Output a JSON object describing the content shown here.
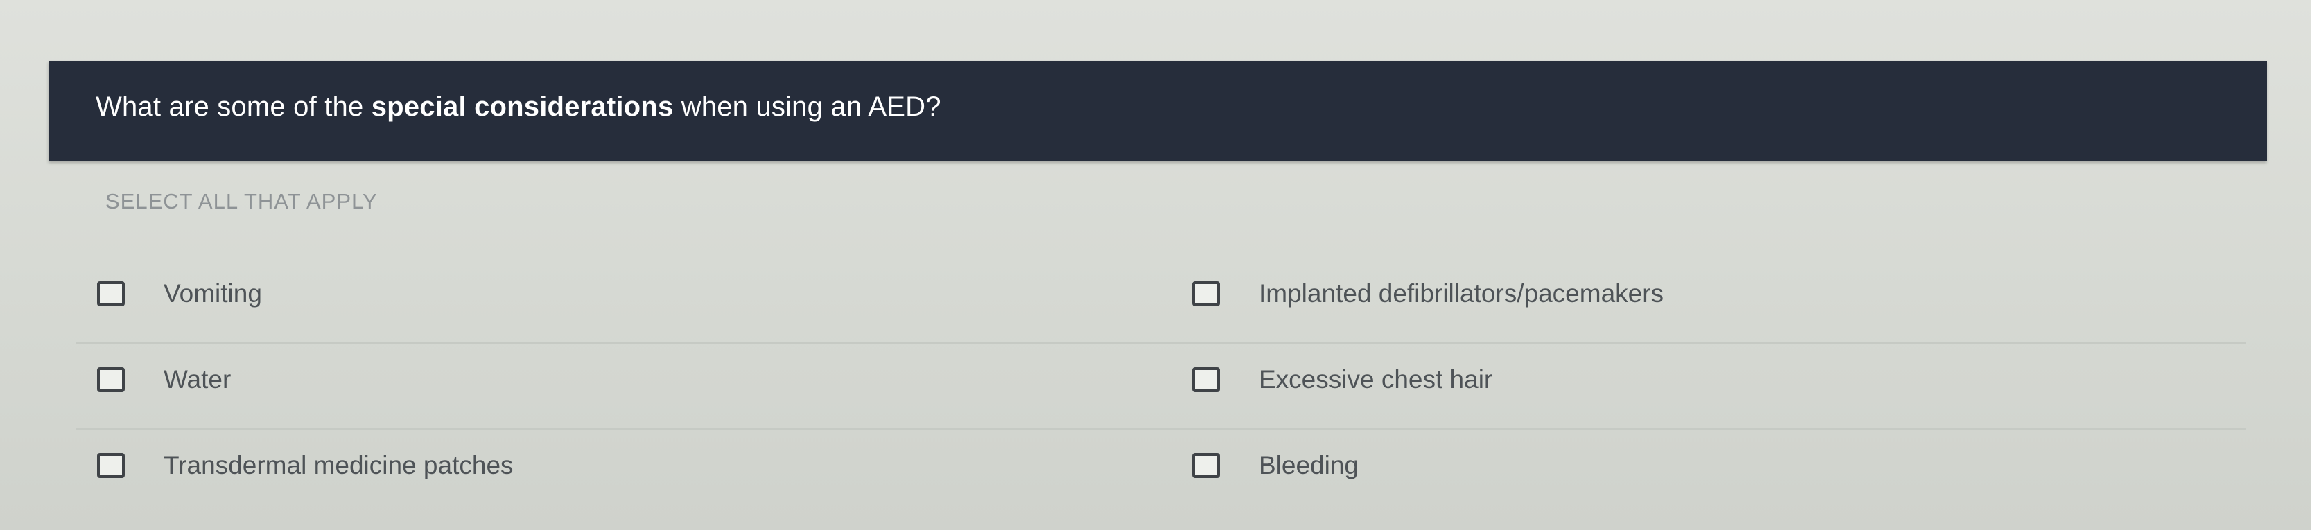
{
  "question": {
    "prefix": "What are some of the ",
    "emphasis": "special considerations",
    "suffix": " when using an AED?"
  },
  "instruction": "SELECT ALL THAT APPLY",
  "options": {
    "left": [
      {
        "label": "Vomiting",
        "checked": false
      },
      {
        "label": "Water",
        "checked": false
      },
      {
        "label": "Transdermal medicine patches",
        "checked": false
      }
    ],
    "right": [
      {
        "label": "Implanted defibrillators/pacemakers",
        "checked": false
      },
      {
        "label": "Excessive chest hair",
        "checked": false
      },
      {
        "label": "Bleeding",
        "checked": false
      }
    ]
  },
  "colors": {
    "banner": "#262d3b",
    "banner_text": "#ffffff",
    "instruction_text": "#8e9396",
    "option_text": "#4e5357"
  }
}
